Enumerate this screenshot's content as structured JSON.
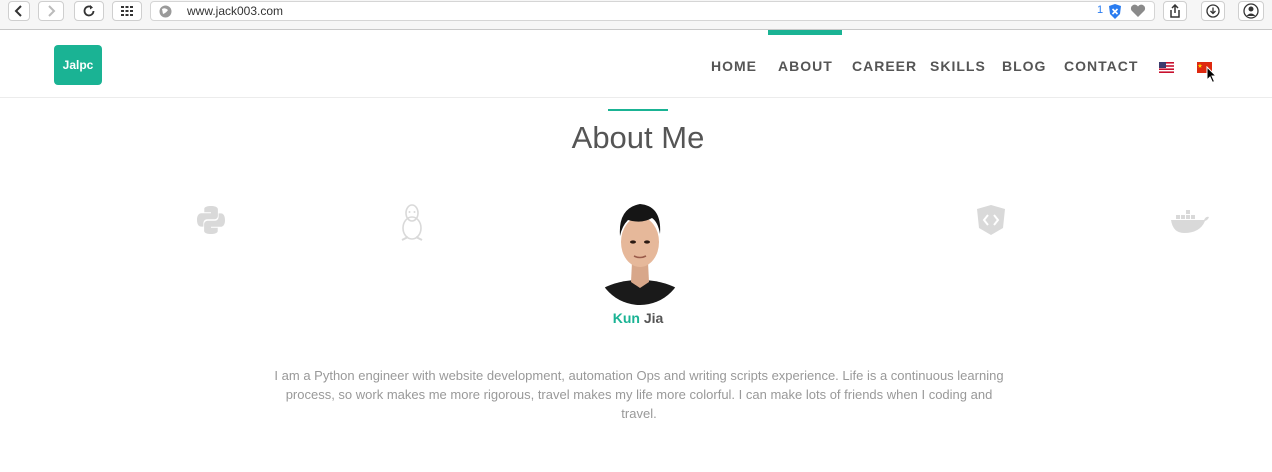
{
  "browser": {
    "url": "www.jack003.com",
    "extension_count": "1"
  },
  "header": {
    "logo_text": "Jalpc",
    "nav": {
      "home": "HOME",
      "about": "ABOUT",
      "career": "CAREER",
      "skills": "SKILLS",
      "blog": "BLOG",
      "contact": "CONTACT"
    },
    "active_item": "ABOUT",
    "languages": [
      "en-us-flag",
      "zh-cn-flag"
    ]
  },
  "about": {
    "title": "About Me",
    "first_name": "Kun",
    "last_name": "Jia",
    "bio": "I am a Python engineer with website development, automation Ops and writing scripts experience. Life is a continuous learning process, so work makes me more rigorous, travel makes my life more colorful. I can make lots of friends when I coding and travel.",
    "skill_icons": [
      "python-icon",
      "linux-icon",
      "code-icon",
      "docker-icon"
    ]
  },
  "colors": {
    "accent": "#1ab394",
    "text": "#555555",
    "muted_text": "#999999"
  }
}
